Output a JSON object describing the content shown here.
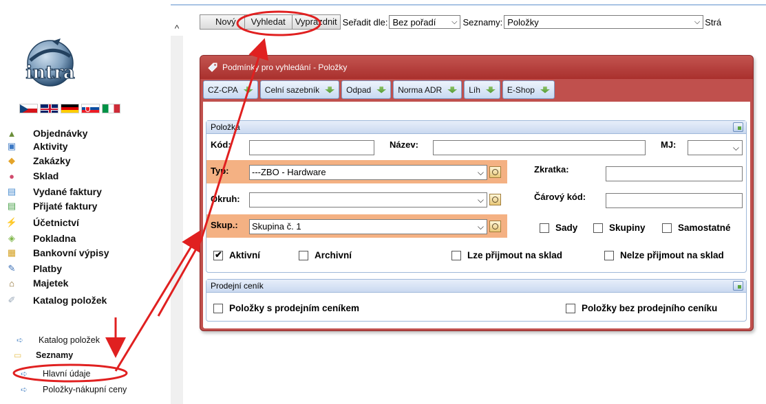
{
  "sidebar": {
    "logo_text": "intra",
    "flags": [
      "cz",
      "gb",
      "de",
      "sk",
      "it"
    ],
    "items": [
      {
        "label": "Objednávky",
        "icon": "orders-icon"
      },
      {
        "label": "Aktivity",
        "icon": "activities-icon"
      },
      {
        "label": "Zakázky",
        "icon": "jobs-icon"
      },
      {
        "label": "Sklad",
        "icon": "warehouse-icon"
      },
      {
        "label": "Vydané faktury",
        "icon": "issued-invoices-icon"
      },
      {
        "label": "Přijaté faktury",
        "icon": "received-invoices-icon"
      },
      {
        "label": "Účetnictví",
        "icon": "accounting-icon"
      },
      {
        "label": "Pokladna",
        "icon": "cashbox-icon"
      },
      {
        "label": "Bankovní výpisy",
        "icon": "bank-statements-icon"
      },
      {
        "label": "Platby",
        "icon": "payments-icon"
      },
      {
        "label": "Majetek",
        "icon": "property-icon"
      },
      {
        "label": "Katalog položek",
        "icon": "catalog-icon"
      }
    ],
    "sub_catalog": "Katalog položek",
    "folder_label": "Seznamy",
    "sub_lists": [
      "Hlavní údaje",
      "Položky-nákupní ceny"
    ]
  },
  "toolbar": {
    "new_label": "Nový",
    "search_label": "Vyhledat",
    "clear_label": "Vyprázdnit",
    "sort_label": "Seřadit dle:",
    "sort_value": "Bez pořadí",
    "lists_label": "Seznamy:",
    "lists_value": "Položky",
    "trailing_label": "Strá"
  },
  "panel": {
    "title": "Podmínky pro vyhledání - Položky",
    "tabs": [
      "CZ-CPA",
      "Celní sazebník",
      "Odpad",
      "Norma ADR",
      "Líh",
      "E-Shop"
    ],
    "group_item": {
      "title": "Položka",
      "code_label": "Kód:",
      "code_value": "",
      "name_label": "Název:",
      "name_value": "",
      "unit_label": "MJ:",
      "unit_value": "",
      "type_label": "Typ:",
      "type_value": "---ZBO - Hardware",
      "shortcut_label": "Zkratka:",
      "shortcut_value": "",
      "area_label": "Okruh:",
      "area_value": "",
      "barcode_label": "Čárový kód:",
      "barcode_value": "",
      "group_label": "Skup.:",
      "group_value": "Skupina č. 1",
      "sets_label": "Sady",
      "groups_label": "Skupiny",
      "standalone_label": "Samostatné",
      "active_label": "Aktivní",
      "archive_label": "Archivní",
      "can_stock_label": "Lze přijmout na sklad",
      "cannot_stock_label": "Nelze přijmout na sklad"
    },
    "group_price": {
      "title": "Prodejní ceník",
      "with_price_label": "Položky s prodejním ceníkem",
      "without_price_label": "Položky bez prodejního ceníku"
    }
  },
  "colors": {
    "panel_red": "#c0504d",
    "highlight_orange": "#f4b183",
    "annotation_red": "#e02020"
  }
}
